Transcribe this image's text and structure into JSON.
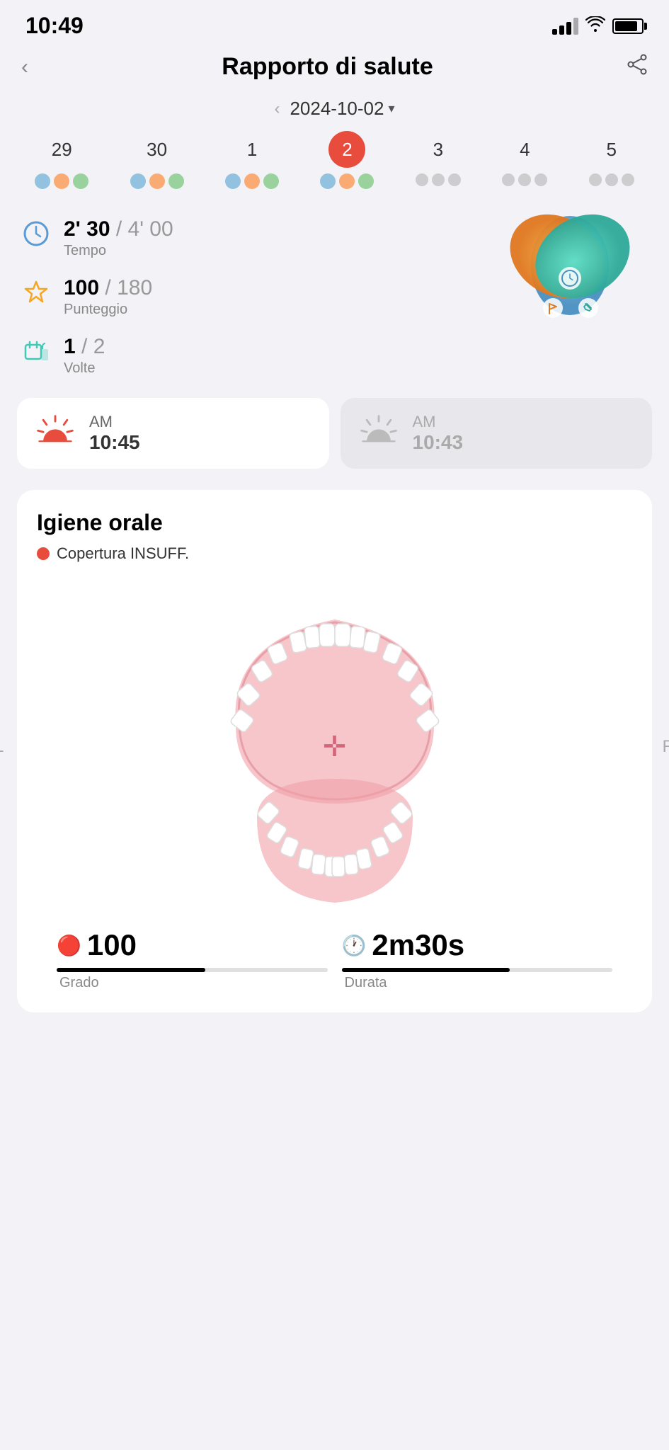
{
  "statusBar": {
    "time": "10:49",
    "wifi": "wifi",
    "battery": "battery"
  },
  "header": {
    "back": "<",
    "title": "Rapporto di salute",
    "share": "share"
  },
  "dateNav": {
    "prev": "<",
    "date": "2024-10-02",
    "dropdownArrow": "▾"
  },
  "calendar": {
    "days": [
      {
        "num": "29",
        "active": false
      },
      {
        "num": "30",
        "active": false
      },
      {
        "num": "1",
        "active": false
      },
      {
        "num": "2",
        "active": true
      },
      {
        "num": "3",
        "active": false
      },
      {
        "num": "4",
        "active": false
      },
      {
        "num": "5",
        "active": false
      }
    ]
  },
  "stats": {
    "time": {
      "value": "2' 30",
      "max": "/ 4' 00",
      "label": "Tempo"
    },
    "score": {
      "value": "100",
      "max": "/ 180",
      "label": "Punteggio"
    },
    "sessions": {
      "value": "1",
      "max": "/ 2",
      "label": "Volte"
    }
  },
  "sessions": {
    "first": {
      "period": "AM",
      "time": "10:45",
      "active": true
    },
    "second": {
      "period": "AM",
      "time": "10:43",
      "active": false
    }
  },
  "hygiene": {
    "title": "Igiene orale",
    "statusDotColor": "#e74c3c",
    "statusText": "Copertura INSUFF.",
    "leftLabel": "L",
    "rightLabel": "R",
    "bottomStats": {
      "grade": {
        "icon": "🔴",
        "value": "100",
        "label": "Grado",
        "progress": 55
      },
      "duration": {
        "icon": "🕐",
        "value": "2m30s",
        "label": "Durata",
        "progress": 62
      }
    }
  },
  "colors": {
    "accent": "#e74c3c",
    "blue": "#5b9bd5",
    "orange": "#f5a623",
    "teal": "#40c9b5",
    "gray": "#bdbdbd"
  }
}
